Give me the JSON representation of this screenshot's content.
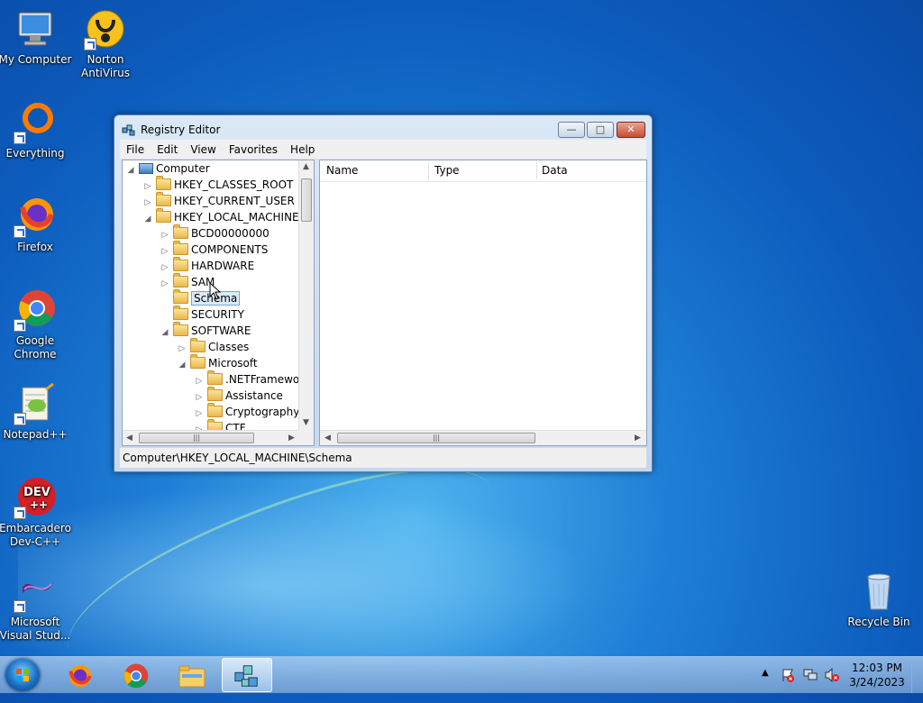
{
  "desktop": {
    "icons": [
      {
        "label": "My Computer"
      },
      {
        "label": "Norton AntiVirus"
      },
      {
        "label": "Everything"
      },
      {
        "label": "Firefox"
      },
      {
        "label": "Google Chrome"
      },
      {
        "label": "Notepad++"
      },
      {
        "label": "Embarcadero Dev-C++"
      },
      {
        "label": "Microsoft Visual Stud..."
      },
      {
        "label": "Recycle Bin"
      }
    ],
    "dev_icon_text": "DEV"
  },
  "window": {
    "title": "Registry Editor",
    "menu": [
      "File",
      "Edit",
      "View",
      "Favorites",
      "Help"
    ],
    "tree": [
      {
        "label": "Computer"
      },
      {
        "label": "HKEY_CLASSES_ROOT"
      },
      {
        "label": "HKEY_CURRENT_USER"
      },
      {
        "label": "HKEY_LOCAL_MACHINE"
      },
      {
        "label": "BCD00000000"
      },
      {
        "label": "COMPONENTS"
      },
      {
        "label": "HARDWARE"
      },
      {
        "label": "SAM"
      },
      {
        "label": "Schema"
      },
      {
        "label": "SECURITY"
      },
      {
        "label": "SOFTWARE"
      },
      {
        "label": "Classes"
      },
      {
        "label": "Microsoft"
      },
      {
        "label": ".NETFramewor"
      },
      {
        "label": "Assistance"
      },
      {
        "label": "Cryptography"
      },
      {
        "label": "CTF"
      }
    ],
    "columns": [
      "Name",
      "Type",
      "Data"
    ],
    "status_path": "Computer\\HKEY_LOCAL_MACHINE\\Schema"
  },
  "taskbar": {
    "clock_time": "12:03 PM",
    "clock_date": "3/24/2023"
  },
  "colors": {
    "accent": "#1f7fd6",
    "selection": "#dbeaf8"
  }
}
